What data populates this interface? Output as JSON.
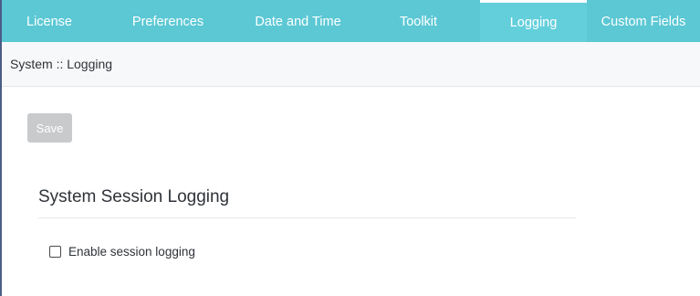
{
  "tabs": [
    {
      "label": "License",
      "active": false
    },
    {
      "label": "Preferences",
      "active": false
    },
    {
      "label": "Date and Time",
      "active": false
    },
    {
      "label": "Toolkit",
      "active": false
    },
    {
      "label": "Logging",
      "active": true
    },
    {
      "label": "Custom Fields",
      "active": false
    }
  ],
  "breadcrumb": "System :: Logging",
  "toolbar": {
    "save_label": "Save"
  },
  "section": {
    "title": "System Session Logging",
    "checkbox_label": "Enable session logging",
    "checkbox_checked": false
  },
  "colors": {
    "nav_background": "#5bc8d4",
    "nav_text": "#ffffff",
    "save_disabled": "#c9cacc",
    "left_border": "#4a5e86"
  }
}
